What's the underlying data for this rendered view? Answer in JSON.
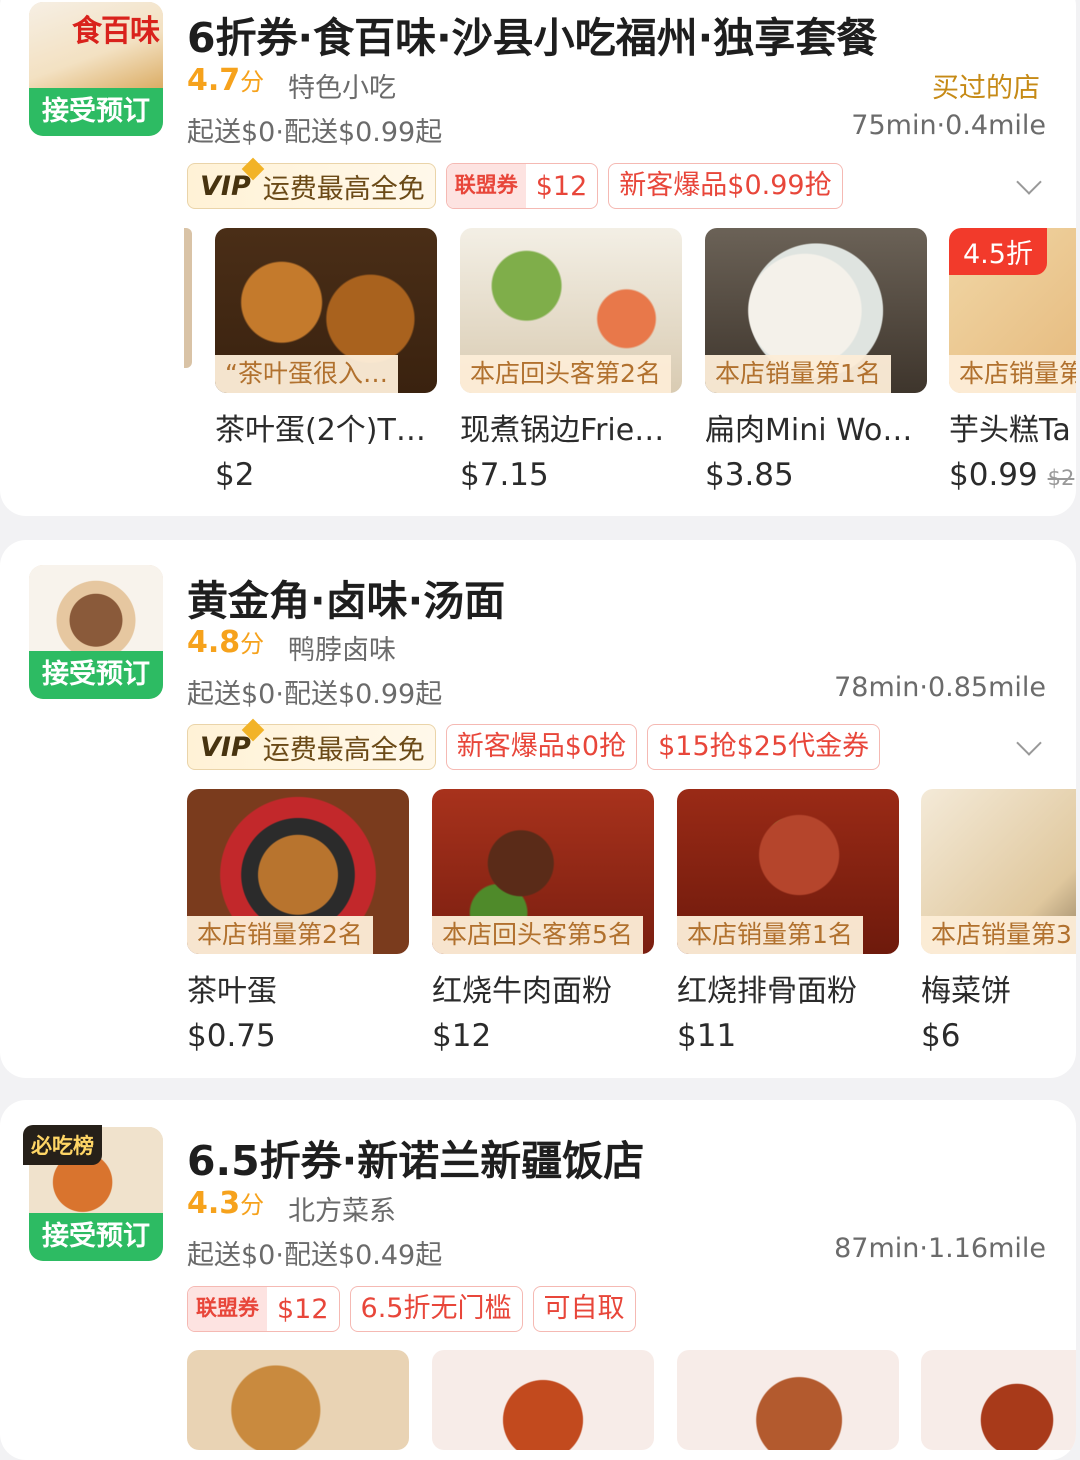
{
  "stores": [
    {
      "brand_text": "食百味",
      "accept_label": "接受预订",
      "title": "6折券·食百味·沙县小吃福州·独享套餐",
      "score": "4.7",
      "score_unit": "分",
      "category": "特色小吃",
      "bought_label": "买过的店",
      "fee": "起送$0·配送$0.99起",
      "distance": "75min·0.4mile",
      "vip_logo": "VIP",
      "vip_text": "运费最高全免",
      "tags": [
        "新客爆品$0.99抢"
      ],
      "union_label": "联盟券",
      "union_value": "$12",
      "dishes": [
        {
          "rank": "“茶叶蛋很入…",
          "name": "茶叶蛋(2个)T…",
          "price": "$2"
        },
        {
          "rank": "本店回头客第2名",
          "name": "现煮锅边Frie…",
          "price": "$7.15"
        },
        {
          "rank": "本店销量第1名",
          "name": "扁肉Mini Wo…",
          "price": "$3.85"
        },
        {
          "rank": "本店销量第",
          "name": "芋头糕Ta",
          "price": "$0.99",
          "orig": "$2",
          "discount": "4.5折"
        }
      ]
    },
    {
      "accept_label": "接受预订",
      "title": "黄金角·卤味·汤面",
      "score": "4.8",
      "score_unit": "分",
      "category": "鸭脖卤味",
      "fee": "起送$0·配送$0.99起",
      "distance": "78min·0.85mile",
      "vip_logo": "VIP",
      "vip_text": "运费最高全免",
      "tags": [
        "新客爆品$0抢",
        "$15抢$25代金券"
      ],
      "dishes": [
        {
          "rank": "本店销量第2名",
          "name": "茶叶蛋",
          "price": "$0.75"
        },
        {
          "rank": "本店回头客第5名",
          "name": "红烧牛肉面粉",
          "price": "$12"
        },
        {
          "rank": "本店销量第1名",
          "name": "红烧排骨面粉",
          "price": "$11"
        },
        {
          "rank": "本店销量第3",
          "name": "梅菜饼",
          "price": "$6"
        }
      ]
    },
    {
      "rank_badge": "必吃榜",
      "accept_label": "接受预订",
      "title": "6.5折券·新诺兰新疆饭店",
      "score": "4.3",
      "score_unit": "分",
      "category": "北方菜系",
      "fee": "起送$0·配送$0.49起",
      "distance": "87min·1.16mile",
      "union_label": "联盟券",
      "union_value": "$12",
      "tags": [
        "6.5折无门槛",
        "可自取"
      ]
    }
  ],
  "colors": {
    "accent": "#f6a21c",
    "green": "#2dbb63",
    "red": "#e8463a"
  }
}
